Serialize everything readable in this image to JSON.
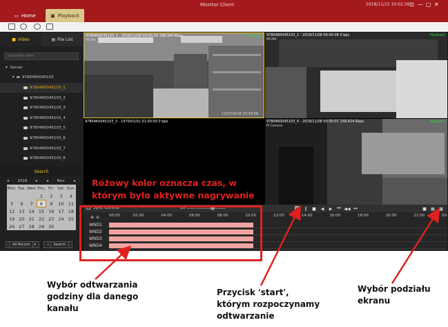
{
  "window": {
    "title": "Monitor Client",
    "datetime": "2018/11/15 10:02:26",
    "controls": [
      "⊡",
      "—",
      "▢",
      "✕"
    ]
  },
  "tabs": [
    {
      "label": "Home",
      "icon": "monitor-icon"
    },
    {
      "label": "Playback",
      "icon": "playback-icon"
    }
  ],
  "left_panel": {
    "tabs": [
      {
        "label": "Video",
        "icon": "video-icon"
      },
      {
        "label": "File List",
        "icon": "file-icon"
      }
    ],
    "search_placeholder": "Input video name",
    "tree": {
      "server": "Server",
      "device": "9780460045103",
      "channels": [
        "9780460045103_1",
        "9780460045103_2",
        "9780460045103_3",
        "9780460045103_4",
        "9780460045103_5",
        "9780460045103_6",
        "9780460045103_7",
        "9780460045103_8"
      ]
    },
    "search_label": "Search",
    "calendar": {
      "year": "2018",
      "month": "Nov.",
      "weekdays": [
        "Mon.",
        "Tue.",
        "Wed.",
        "Thu.",
        "Fri.",
        "Sat.",
        "Sun."
      ],
      "rows": [
        [
          "",
          "",
          "",
          "1",
          "2",
          "3",
          "4"
        ],
        [
          "5",
          "6",
          "7",
          "8",
          "9",
          "10",
          "11"
        ],
        [
          "12",
          "13",
          "14",
          "15",
          "16",
          "17",
          "18"
        ],
        [
          "19",
          "20",
          "21",
          "22",
          "23",
          "24",
          "25"
        ],
        [
          "26",
          "27",
          "28",
          "29",
          "30",
          "",
          ""
        ]
      ],
      "highlighted": "8"
    },
    "record_filter": "All Record",
    "search_button": "Search"
  },
  "panes": [
    {
      "header": "9780460045103_1 - 2018/11/08 00:00:16 198.360 Kbps",
      "status": "Playback",
      "sub": "IPCAM",
      "timestamp": "11/07/2018 23:59:59"
    },
    {
      "header": "9780460045103_2 - 2018/11/08 00:00:08 0 bps",
      "status": "Playback",
      "sub": "IPCAM",
      "timestamp": ""
    },
    {
      "header": "9780460045103_3 - 1970/01/01 01:00:00 0 bps",
      "status": "",
      "sub": "",
      "timestamp": ""
    },
    {
      "header": "9780460045103_4 - 2018/11/08 00:00:07 158.424 Kbps",
      "status": "Playback",
      "sub": "IP Camera",
      "timestamp": ""
    }
  ],
  "sync": {
    "label": "Sync Control",
    "speed": "1x",
    "ticks": [
      "00:00",
      "02:00",
      "04:00",
      "06:00",
      "08:00",
      "10:00",
      "12:00",
      "14:00",
      "16:00",
      "18:00",
      "20:00",
      "22:00",
      "00:00"
    ],
    "windows": [
      "WND1",
      "WND2",
      "WND3",
      "WND4"
    ],
    "recorded_until_hour": 10.3
  },
  "annotations": {
    "red_note": [
      "Różowy kolor oznacza czas, w",
      "którym było aktywne nagrywanie"
    ],
    "left_note": [
      "Wybór odtwarzania",
      "godziny dla danego",
      "kanału"
    ],
    "middle_note": [
      "Przycisk 'start',",
      "którym rozpoczynamy",
      "odtwarzanie"
    ],
    "right_note": [
      "Wybór podziału",
      "ekranu"
    ]
  },
  "colors": {
    "titlebar": "#a3191c",
    "accent": "#f5c518",
    "recorded": "#f4a3a3",
    "annotation": "#e02020"
  }
}
